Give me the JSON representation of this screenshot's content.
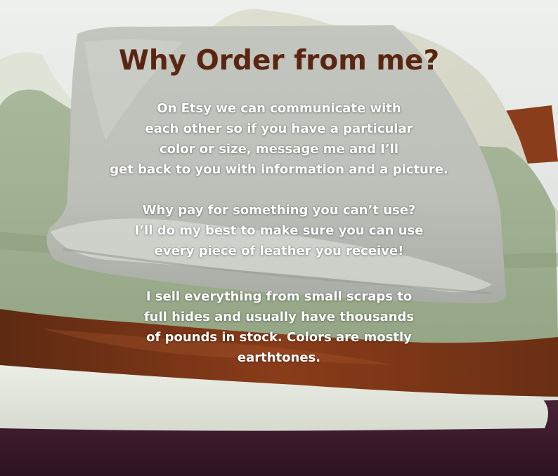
{
  "headline": "Why Order from me?",
  "paragraphs": [
    {
      "lines": [
        "On Etsy we can communicate with",
        "each other so if you have a particular",
        "color or size, message me and I’ll",
        "get back to you with information and a picture."
      ]
    },
    {
      "lines": [
        "Why pay for something you can’t use?",
        "I’ll do my best to make sure you can use",
        "every piece of leather you receive!"
      ]
    },
    {
      "lines": [
        "I sell everything from small scraps to",
        "full hides and usually have thousands",
        "of pounds in stock.  Colors are mostly",
        "earthtones."
      ]
    }
  ],
  "colors": {
    "headline": "#5a2612",
    "body_text": "#ffffff",
    "grey_leather": "#c9cbc6",
    "sage_leather": "#a3b394",
    "brown_leather": "#7a3417",
    "cream_leather": "#e4e7df",
    "plum_leather": "#3a1a2c",
    "suede": "#dcdccd"
  }
}
